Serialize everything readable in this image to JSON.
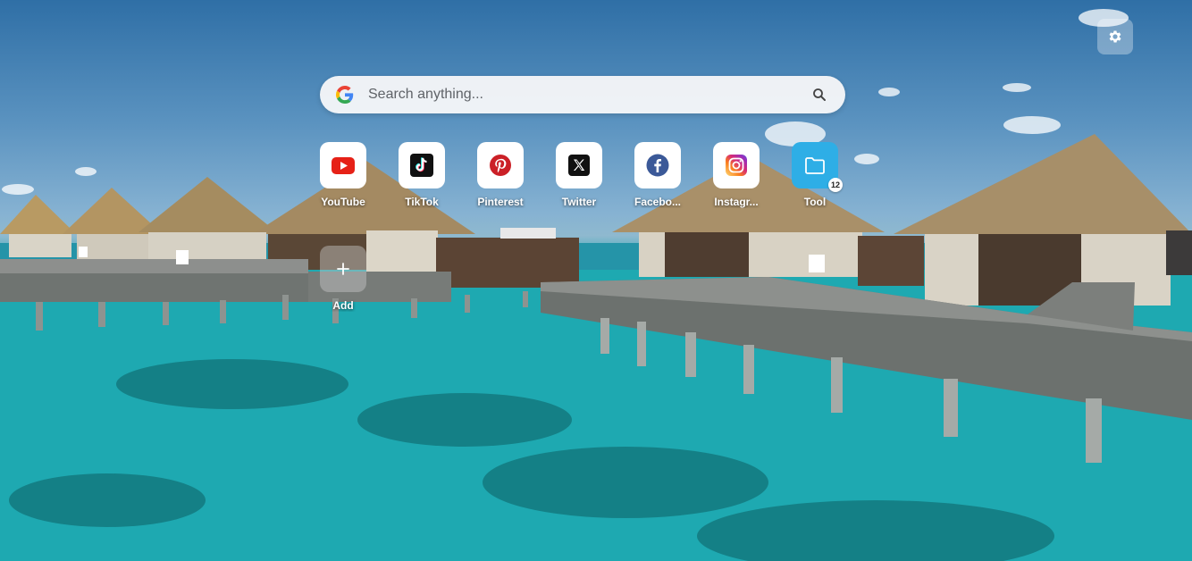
{
  "search": {
    "placeholder": "Search anything..."
  },
  "shortcuts": [
    {
      "label": "YouTube",
      "icon": "youtube-icon"
    },
    {
      "label": "TikTok",
      "icon": "tiktok-icon"
    },
    {
      "label": "Pinterest",
      "icon": "pinterest-icon"
    },
    {
      "label": "Twitter",
      "icon": "x-icon"
    },
    {
      "label": "Facebo...",
      "icon": "facebook-icon"
    },
    {
      "label": "Instagr...",
      "icon": "instagram-icon"
    },
    {
      "label": "Tool",
      "icon": "folder-icon",
      "badge": "12"
    }
  ],
  "add_tile": {
    "label": "Add"
  },
  "colors": {
    "youtube": "#e62117",
    "pinterest": "#cb2027",
    "facebook": "#3b5998",
    "folder": "#2eaee6"
  }
}
